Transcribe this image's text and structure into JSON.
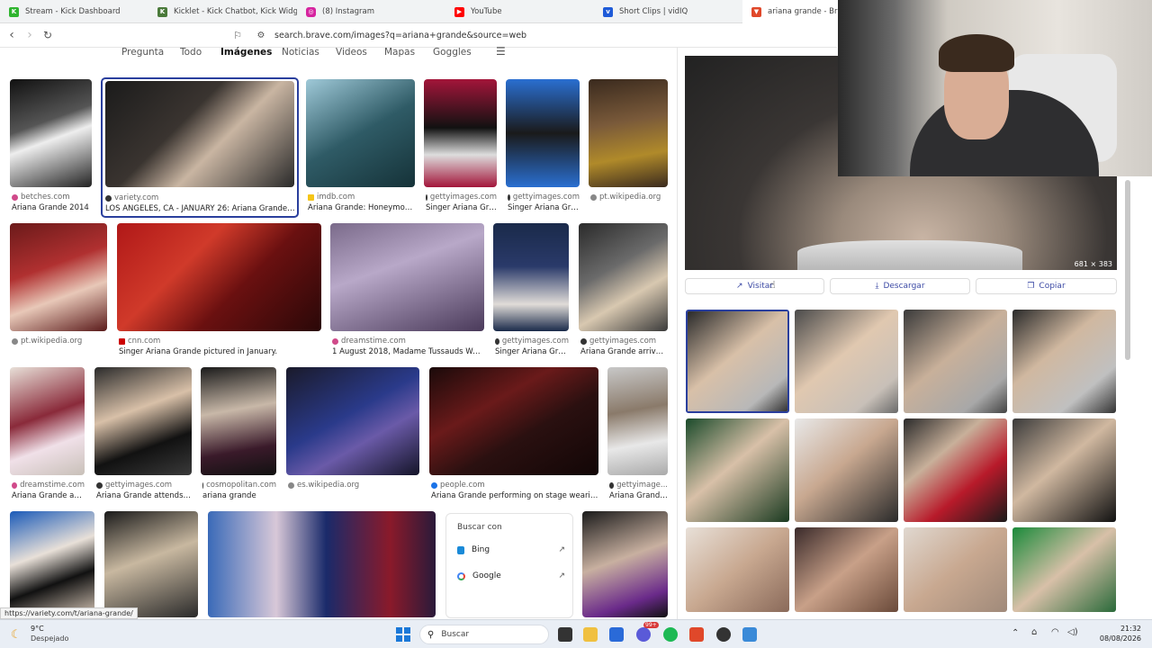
{
  "browser": {
    "tabs": [
      {
        "label": "Stream - Kick Dashboard",
        "icon": "kick-logo-icon",
        "color": "#2fb52f"
      },
      {
        "label": "Kicklet - Kick Chatbot, Kick Widgets ..",
        "icon": "kicklet-logo-icon",
        "color": "#4a7a3a"
      },
      {
        "label": "(8) Instagram",
        "icon": "instagram-logo-icon",
        "color": "#d6249f"
      },
      {
        "label": "YouTube",
        "icon": "youtube-logo-icon",
        "color": "#ff0000"
      },
      {
        "label": "Short Clips | vidIQ",
        "icon": "vidiq-logo-icon",
        "color": "#1f5bd8"
      },
      {
        "label": "ariana grande - Brave Se",
        "icon": "brave-logo-icon",
        "color": "#e0482a"
      }
    ],
    "url": "search.brave.com/images?q=ariana+grande&source=web",
    "status_url": "https://variety.com/t/ariana-grande/"
  },
  "search_tabs": [
    "Pregunta",
    "Todo",
    "Imágenes",
    "Noticias",
    "Videos",
    "Mapas",
    "Goggles"
  ],
  "selected_tab": "Imágenes",
  "results": [
    {
      "source": "betches.com",
      "title": "Ariana Grande 2014",
      "dot": "#d04a8a"
    },
    {
      "source": "variety.com",
      "title": "LOS ANGELES, CA - JANUARY 26: Ariana Grande atte...",
      "dot": "#333333"
    },
    {
      "source": "imdb.com",
      "title": "Ariana Grande: Honeymoon ...",
      "dot": "#f5c518"
    },
    {
      "source": "gettyimages.com",
      "title": "Singer Ariana Gra...",
      "dot": "#333333"
    },
    {
      "source": "gettyimages.com",
      "title": "Singer Ariana Gra...",
      "dot": "#333333"
    },
    {
      "source": "pt.wikipedia.org",
      "title": "",
      "dot": "#888888"
    },
    {
      "source": "pt.wikipedia.org",
      "title": "",
      "dot": "#888888"
    },
    {
      "source": "cnn.com",
      "title": "Singer Ariana Grande pictured in January.",
      "dot": "#cc0000"
    },
    {
      "source": "dreamstime.com",
      "title": "1 August 2018, Madame Tussauds Wax m...",
      "dot": "#d04a8a"
    },
    {
      "source": "gettyimages.com",
      "title": "Singer Ariana Gran...",
      "dot": "#333333"
    },
    {
      "source": "gettyimages.com",
      "title": "Ariana Grande arrives a...",
      "dot": "#333333"
    },
    {
      "source": "dreamstime.com",
      "title": "Ariana Grande at th...",
      "dot": "#d04a8a"
    },
    {
      "source": "gettyimages.com",
      "title": "Ariana Grande attends th...",
      "dot": "#333333"
    },
    {
      "source": "cosmopolitan.com",
      "title": "ariana grande",
      "dot": "#333333"
    },
    {
      "source": "es.wikipedia.org",
      "title": "",
      "dot": "#888888"
    },
    {
      "source": "people.com",
      "title": "Ariana Grande performing on stage wearing a l...",
      "dot": "#1a73e8"
    },
    {
      "source": "gettyimage...",
      "title": "Ariana Grande ...",
      "dot": "#333333"
    }
  ],
  "search_with": {
    "heading": "Buscar con",
    "engines": [
      "Bing",
      "Google"
    ]
  },
  "preview": {
    "dimensions": "681 × 383",
    "visit": "Visitar",
    "download": "Descargar",
    "copy": "Copiar"
  },
  "taskbar": {
    "temperature": "9°C",
    "weather": "Despejado",
    "search_placeholder": "Buscar",
    "time": "21:32",
    "date": "08/08/2026",
    "badge": "99+"
  }
}
